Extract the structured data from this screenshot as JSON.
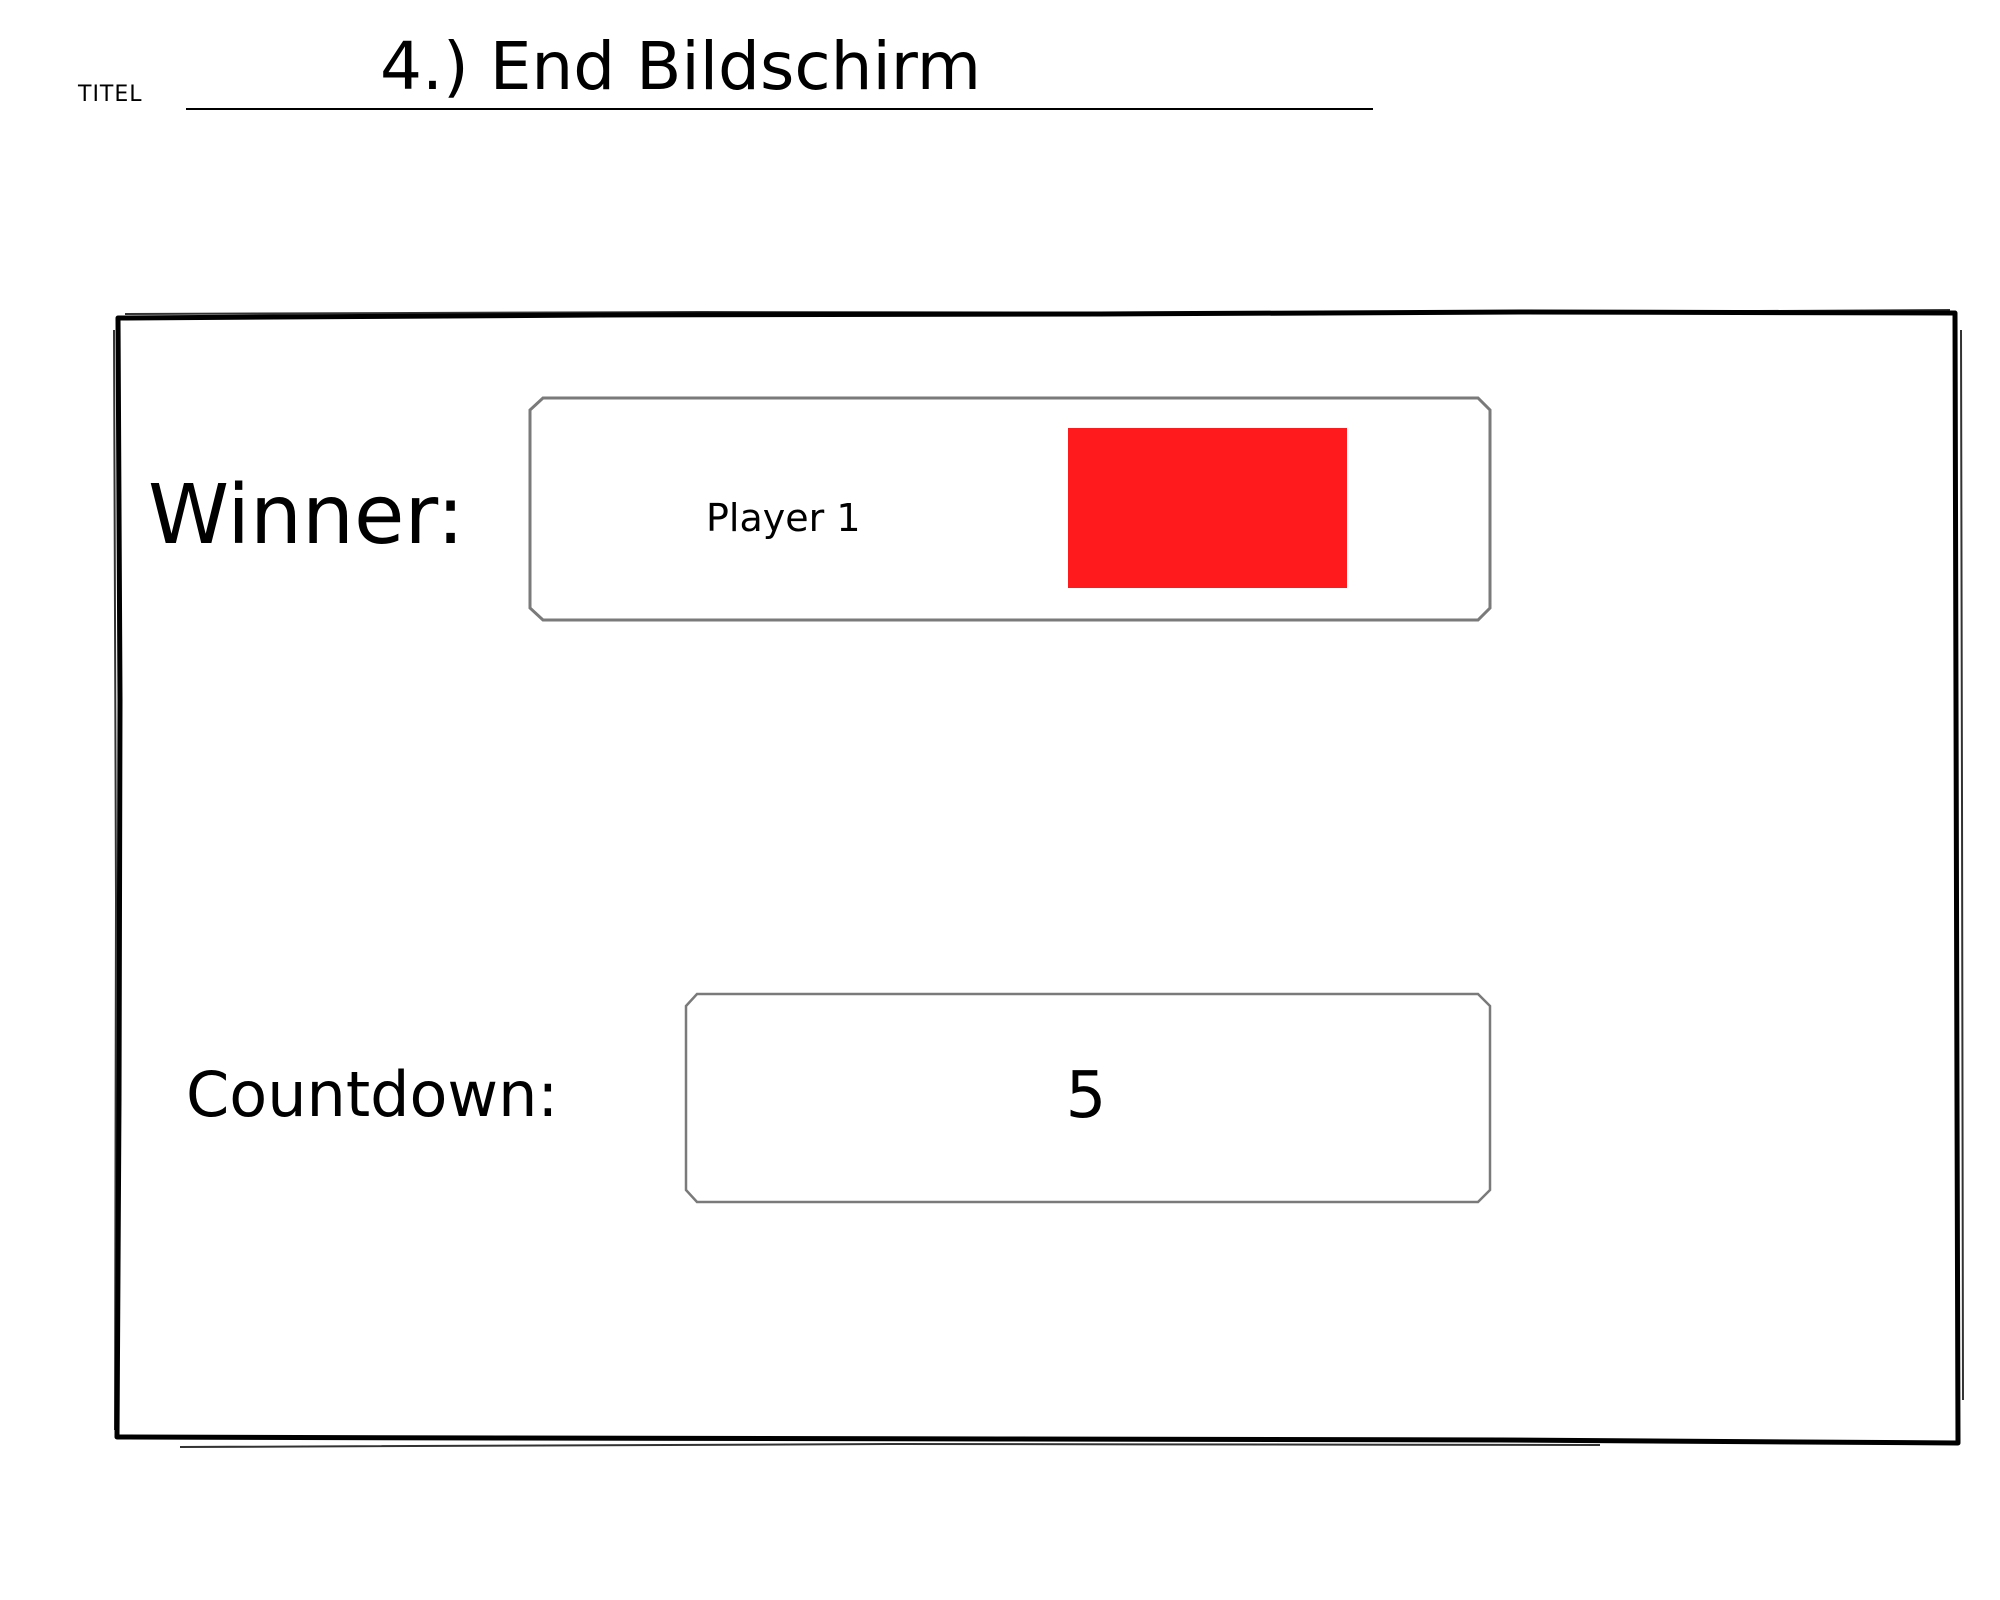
{
  "header": {
    "label": "TITEL",
    "title": "4.) End Bildschirm"
  },
  "screen": {
    "winner_label": "Winner:",
    "winner_name": "Player 1",
    "winner_color": "#ff1a1d",
    "countdown_label": "Countdown:",
    "countdown_value": "5"
  }
}
